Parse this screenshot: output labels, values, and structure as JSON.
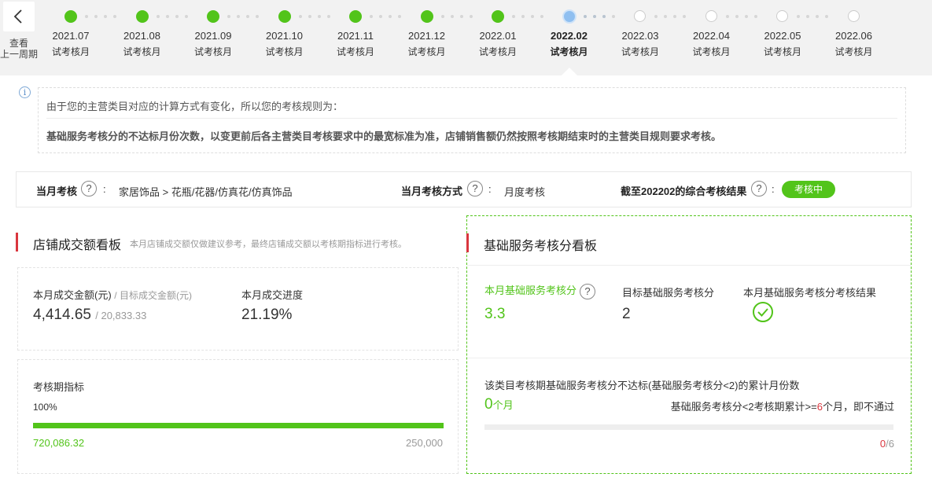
{
  "timeline": {
    "back_label_line1": "查看",
    "back_label_line2": "上一周期",
    "items": [
      {
        "month": "2021.07",
        "status": "试考核月",
        "state": "done"
      },
      {
        "month": "2021.08",
        "status": "试考核月",
        "state": "done"
      },
      {
        "month": "2021.09",
        "status": "试考核月",
        "state": "done"
      },
      {
        "month": "2021.10",
        "status": "试考核月",
        "state": "done"
      },
      {
        "month": "2021.11",
        "status": "试考核月",
        "state": "done"
      },
      {
        "month": "2021.12",
        "status": "试考核月",
        "state": "done"
      },
      {
        "month": "2022.01",
        "status": "试考核月",
        "state": "done"
      },
      {
        "month": "2022.02",
        "status": "试考核月",
        "state": "current"
      },
      {
        "month": "2022.03",
        "status": "试考核月",
        "state": "future"
      },
      {
        "month": "2022.04",
        "status": "试考核月",
        "state": "future"
      },
      {
        "month": "2022.05",
        "status": "试考核月",
        "state": "future"
      },
      {
        "month": "2022.06",
        "status": "试考核月",
        "state": "future"
      }
    ]
  },
  "notice": {
    "line1": "由于您的主营类目对应的计算方式有变化，所以您的考核规则为：",
    "line2": "基础服务考核分的不达标月份次数，以变更前后各主营类目考核要求中的最宽标准为准，店铺销售额仍然按照考核期结束时的主营类目规则要求考核。"
  },
  "infobar": {
    "category_label": "当月考核",
    "category_value": "家居饰品 > 花瓶/花器/仿真花/仿真饰品",
    "method_label": "当月考核方式",
    "method_value": "月度考核",
    "result_label": "截至202202的综合考核结果",
    "result_badge": "考核中",
    "colon": ":",
    "help": "?"
  },
  "sales_board": {
    "title": "店铺成交额看板",
    "note": "本月店铺成交额仅做建议参考，最终店铺成交额以考核期指标进行考核。",
    "amount_label": "本月成交金额(元)",
    "target_label": "/ 目标成交金额(元)",
    "amount_value": "4,414.65",
    "target_value": "/ 20,833.33",
    "progress_label": "本月成交进度",
    "progress_value": "21.19%",
    "period_label": "考核期指标",
    "period_percent": "100%",
    "period_fill": 1.0,
    "period_current": "720,086.32",
    "period_target": "250,000"
  },
  "service_board": {
    "title": "基础服务考核分看板",
    "score_label": "本月基础服务考核分",
    "score_value": "3.3",
    "target_label": "目标基础服务考核分",
    "target_value": "2",
    "result_label": "本月基础服务考核分考核结果",
    "fail_label": "该类目考核期基础服务考核分不达标(基础服务考核分<2)的累计月份数",
    "fail_count": "0",
    "fail_unit": "个月",
    "rule_prefix": "基础服务考核分<2考核期累计>=",
    "rule_num": "6",
    "rule_suffix": "个月，即不通过",
    "fail_fill": 0,
    "ratio_num": "0",
    "ratio_den": "/6"
  },
  "colors": {
    "green": "#52c41a",
    "red": "#d9363e",
    "current_blue": "#8fbff0"
  }
}
